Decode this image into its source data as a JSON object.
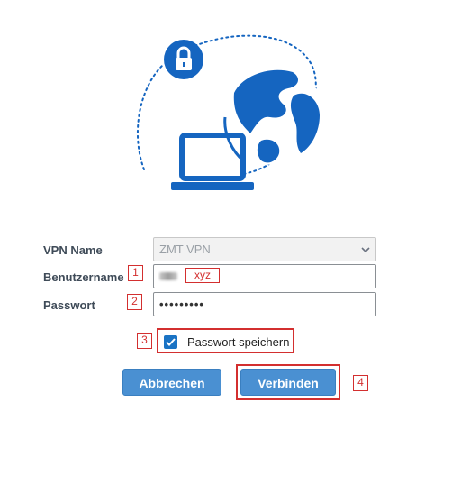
{
  "form": {
    "vpn_name_label": "VPN Name",
    "vpn_name_value": "ZMT VPN",
    "username_label": "Benutzername",
    "username_annotation": "xyz",
    "password_label": "Passwort",
    "password_value": "•••••••••",
    "save_password_label": "Passwort speichern",
    "save_password_checked": true
  },
  "buttons": {
    "cancel_label": "Abbrechen",
    "connect_label": "Verbinden"
  },
  "annotations": [
    "1",
    "2",
    "3",
    "4"
  ],
  "colors": {
    "accent": "#1565c0",
    "button": "#4a90d2",
    "annotation": "#d32f2f"
  },
  "icons": [
    "lock-icon",
    "globe-icon",
    "laptop-icon",
    "chevron-down-icon",
    "checkmark-icon"
  ]
}
